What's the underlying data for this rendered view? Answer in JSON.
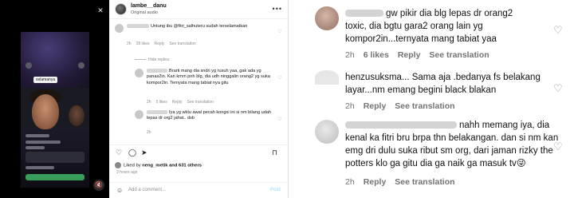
{
  "post": {
    "username": "lambe__danu",
    "audio": "Original audio",
    "more_icon": "more-horizontal-icon",
    "comments": [
      {
        "text": "Untung ibu @fitri_salhuteru sudah terselamatkan",
        "time": "2h",
        "likes": "28 likes",
        "reply": "Reply",
        "translate": "See translation"
      }
    ],
    "hide_replies": "Hide replies",
    "replies": [
      {
        "text": "Brarti mang dia sndri yg rusuh yaa, gak ada yg panas2in. Kan kmrn pnh blg, dia udh ninggalin orang2 yg suka kompor2in. Ternyata mang tabiat nya gitu",
        "time": "2h",
        "likes": "5 likes",
        "reply": "Reply",
        "translate": "See translation"
      },
      {
        "text": "Iya yg wktu awal pecah kongsi ini si nm bilang udah lepas dr org2 jahat.. dsb",
        "time": "2h",
        "likes": "",
        "reply": "",
        "translate": ""
      }
    ],
    "liked_by_prefix": "Liked by",
    "liked_by_user": "neng_metik",
    "liked_by_suffix": "and 631 others",
    "time_ago": "3 hours ago",
    "add_comment_placeholder": "Add a comment...",
    "post_button": "Post"
  },
  "right_comments": [
    {
      "text_lines": [
        "gw pikir dia blg lepas dr orang2",
        "toxic, dia bgtu gara2 orang lain yg",
        "kompor2in...ternyata mang tabiat yaa"
      ],
      "time": "2h",
      "likes": "6 likes",
      "reply": "Reply",
      "translate": "See translation"
    },
    {
      "text_lines": [
        "henzusuksma... Sama aja .bedanya fs belakang",
        "layar...nm emang begini black blakan"
      ],
      "time": "2h",
      "likes": "",
      "reply": "Reply",
      "translate": "See translation"
    },
    {
      "text_lines": [
        "nahh memang iya, dia",
        "kenal ka fitri bru brpa thn belakangan. dan si nm kan",
        "emg dri dulu suka ribut sm org, dari jaman rizky the",
        "potters klo ga gitu dia ga naik ga masuk tv😜"
      ],
      "time": "2h",
      "likes": "",
      "reply": "Reply",
      "translate": "See translation"
    }
  ],
  "video": {
    "name_tag": "selamanya",
    "mute_icon": "speaker-muted-icon"
  }
}
